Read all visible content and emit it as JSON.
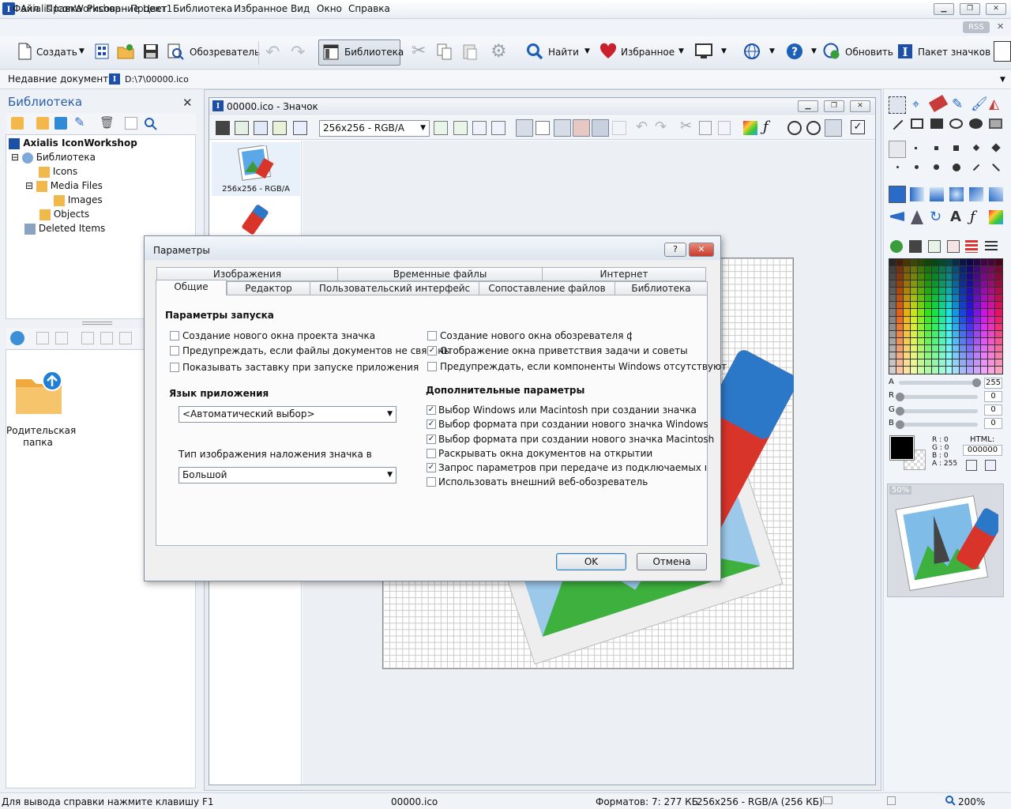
{
  "app": {
    "title": "Axialis IconWorkshop - Проект1",
    "logo_letter": "I"
  },
  "menu": [
    "Файл",
    "Правка",
    "Рисование",
    "Цвет",
    "Библиотека",
    "Избранное",
    "Вид",
    "Окно",
    "Справка"
  ],
  "rss_label": "RSS",
  "toolbar": {
    "create": "Создать",
    "browser": "Обозреватель",
    "library": "Библиотека",
    "find": "Найти",
    "favorites": "Избранное",
    "update": "Обновить",
    "icon_pack": "Пакет значков"
  },
  "recent": {
    "label": "Недавние документы",
    "path": "D:\\7\\00000.ico"
  },
  "library_panel": {
    "title": "Библиотека",
    "tree": [
      {
        "label": "Axialis IconWorkshop",
        "bold": true
      },
      {
        "label": "Библиотека"
      },
      {
        "label": "Icons"
      },
      {
        "label": "Media Files"
      },
      {
        "label": "Images"
      },
      {
        "label": "Objects"
      },
      {
        "label": "Deleted Items"
      }
    ],
    "parent_folder_label": "Родительская папка"
  },
  "document": {
    "title": "00000.ico - Значок",
    "format_select": "256x256 - RGB/A",
    "format_thumb_label": "256x256 - RGB/A"
  },
  "color_panel": {
    "channels": [
      {
        "name": "A",
        "value": "255",
        "level": 1.0
      },
      {
        "name": "R",
        "value": "0",
        "level": 0
      },
      {
        "name": "G",
        "value": "0",
        "level": 0
      },
      {
        "name": "B",
        "value": "0",
        "level": 0
      }
    ],
    "rgb_readout": {
      "r": "R : 0",
      "g": "G : 0",
      "b": "B : 0",
      "a": "A : 255"
    },
    "html_label": "HTML:",
    "html_value": "000000",
    "preview_zoom": "50%"
  },
  "dialog": {
    "title": "Параметры",
    "help_btn": "?",
    "tabs_row1": [
      "Изображения",
      "Временные файлы",
      "Интернет"
    ],
    "tabs_row2": [
      "Общие",
      "Редактор",
      "Пользовательский интерфейс",
      "Сопоставление файлов",
      "Библиотека"
    ],
    "startup_title": "Параметры запуска",
    "startup_left": [
      {
        "label": "Создание нового окна проекта значка",
        "checked": false
      },
      {
        "label": "Предупреждать, если файлы документов не связаны",
        "checked": false
      },
      {
        "label": "Показывать заставку при запуске приложения",
        "checked": false
      }
    ],
    "startup_right": [
      {
        "label": "Создание нового окна обозревателя файлов",
        "checked": false
      },
      {
        "label": "Отображение окна приветствия задачи и советы",
        "checked": true
      },
      {
        "label": "Предупреждать, если компоненты Windows отсутствуют",
        "checked": false
      }
    ],
    "lang_title": "Язык приложения",
    "lang_value": "<Автоматический выбор>",
    "overlay_title": "Тип изображения наложения значка в",
    "overlay_value": "Большой",
    "extra_title": "Дополнительные параметры",
    "extra": [
      {
        "label": "Выбор Windows или Macintosh при создании значка",
        "checked": true
      },
      {
        "label": "Выбор формата при создании нового значка Windows",
        "checked": true
      },
      {
        "label": "Выбор формата при создании нового значка Macintosh",
        "checked": true
      },
      {
        "label": "Раскрывать окна документов на открытии",
        "checked": false
      },
      {
        "label": "Запрос параметров при передаче из подключаемых модулей",
        "checked": true
      },
      {
        "label": "Использовать внешний веб-обозреватель",
        "checked": false
      }
    ],
    "ok": "OK",
    "cancel": "Отмена"
  },
  "status": {
    "help": "Для вывода справки нажмите клавишу F1",
    "file": "00000.ico",
    "formats": "Форматов: 7: 277 КБ",
    "format_info": "256x256 - RGB/A (256 КБ)",
    "zoom": "200%"
  },
  "colors": {
    "accent": "#2b5da8",
    "heart": "#c8202c"
  }
}
